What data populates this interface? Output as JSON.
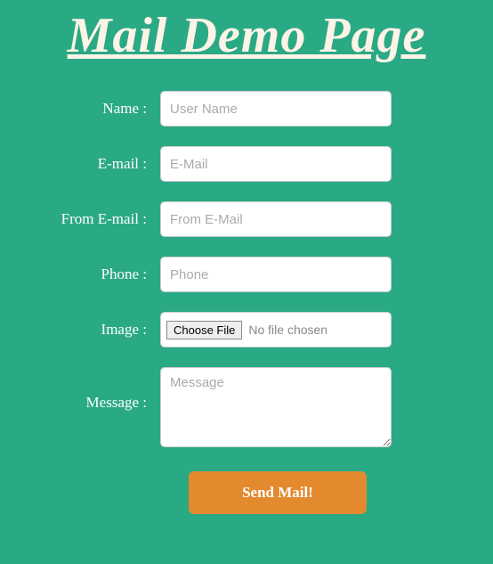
{
  "title": "Mail Demo Page",
  "fields": {
    "name": {
      "label": "Name :",
      "placeholder": "User Name"
    },
    "email": {
      "label": "E-mail :",
      "placeholder": "E-Mail"
    },
    "from_email": {
      "label": "From E-mail :",
      "placeholder": "From E-Mail"
    },
    "phone": {
      "label": "Phone :",
      "placeholder": "Phone"
    },
    "image": {
      "label": "Image :",
      "button": "Choose File",
      "status": "No file chosen"
    },
    "message": {
      "label": "Message :",
      "placeholder": "Message"
    }
  },
  "submit_label": "Send Mail!"
}
